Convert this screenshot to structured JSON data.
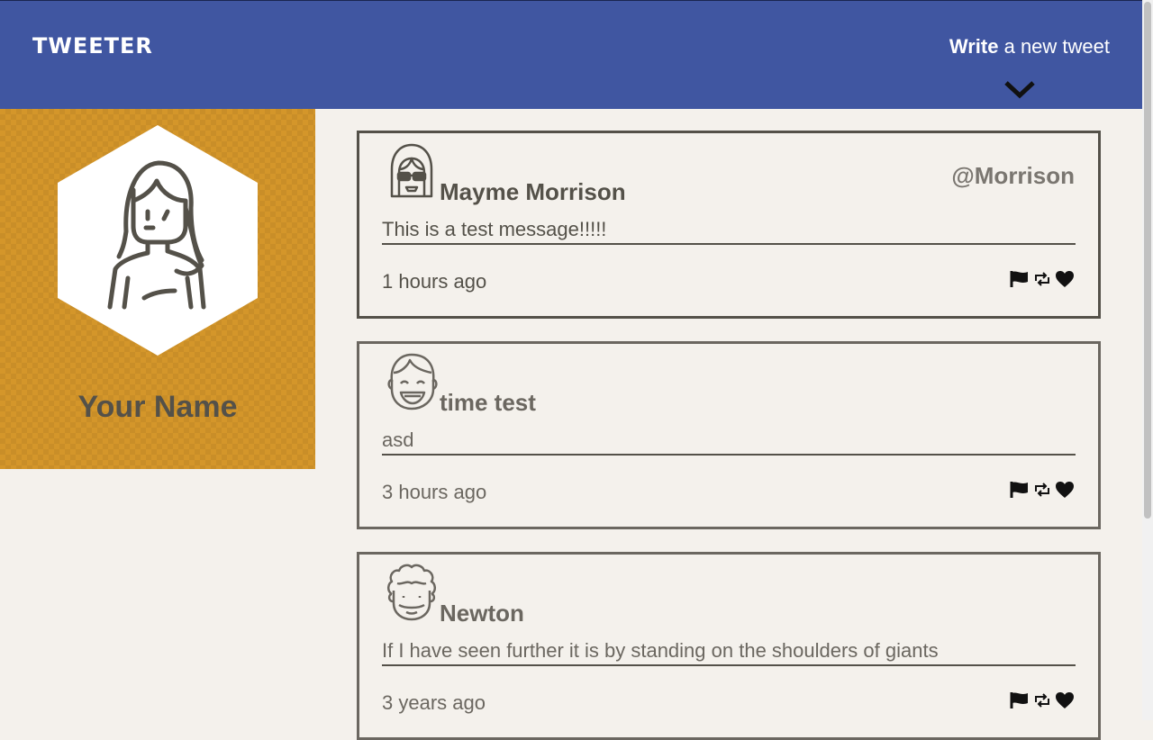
{
  "nav": {
    "brand": "TWEETER",
    "compose_bold": "Write",
    "compose_rest": " a new tweet"
  },
  "profile": {
    "name": "Your Name"
  },
  "tweets": [
    {
      "name": "Mayme Morrison",
      "handle": "@Morrison",
      "message": "This is a test message!!!!!",
      "time": "1 hours ago"
    },
    {
      "name": "time test",
      "handle": "",
      "message": "asd",
      "time": "3 hours ago"
    },
    {
      "name": "Newton",
      "handle": "",
      "message": "If I have seen further it is by standing on the shoulders of giants",
      "time": "3 years ago"
    }
  ],
  "colors": {
    "nav": "#4056a1",
    "profile": "#d4962a",
    "background": "#f4f1ec",
    "text": "#545149"
  },
  "icons": [
    "chevron-down-icon",
    "flag-icon",
    "retweet-icon",
    "heart-icon"
  ]
}
